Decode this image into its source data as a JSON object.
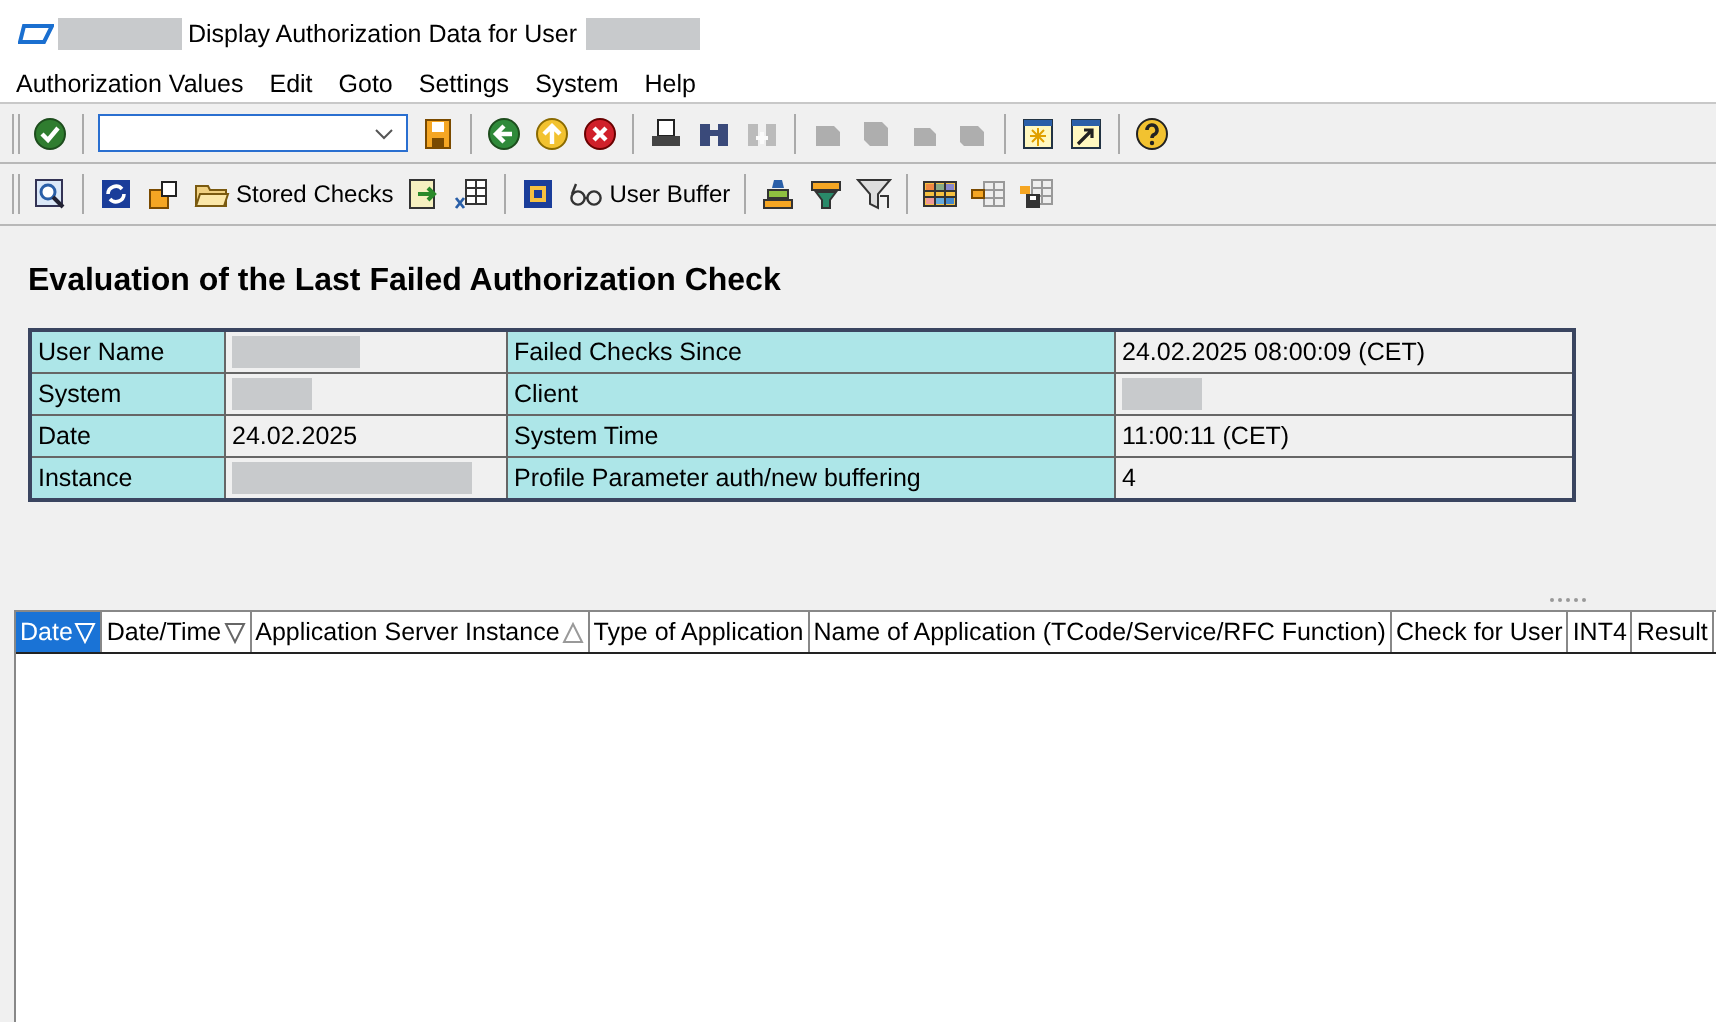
{
  "window": {
    "title": "Display Authorization Data for User",
    "title_redacted": true,
    "user_redacted": true
  },
  "menu": [
    "Authorization Values",
    "Edit",
    "Goto",
    "Settings",
    "System",
    "Help"
  ],
  "toolbar": [
    {
      "kind": "button",
      "disabled": false
    },
    {
      "kind": "separator"
    },
    {
      "kind": "field"
    },
    {
      "kind": "button",
      "disabled": false
    },
    {
      "kind": "separator"
    },
    {
      "kind": "button",
      "disabled": false
    },
    {
      "kind": "button",
      "disabled": false
    },
    {
      "kind": "button",
      "disabled": false
    },
    {
      "kind": "separator"
    },
    {
      "kind": "button",
      "disabled": false
    },
    {
      "kind": "button",
      "disabled": false
    },
    {
      "kind": "button",
      "disabled": true
    },
    {
      "kind": "separator"
    },
    {
      "kind": "button",
      "disabled": true
    },
    {
      "kind": "button",
      "disabled": true
    },
    {
      "kind": "button",
      "disabled": true
    },
    {
      "kind": "button",
      "disabled": true
    },
    {
      "kind": "separator"
    },
    {
      "kind": "button",
      "disabled": false
    },
    {
      "kind": "button",
      "disabled": false
    },
    {
      "kind": "separator"
    },
    {
      "kind": "button",
      "disabled": false
    }
  ],
  "app_toolbar": [
    {
      "kind": "button"
    },
    {
      "kind": "separator"
    },
    {
      "kind": "button"
    },
    {
      "kind": "button"
    },
    {
      "kind": "button",
      "label": "Stored Checks"
    },
    {
      "kind": "button"
    },
    {
      "kind": "button"
    },
    {
      "kind": "separator"
    },
    {
      "kind": "button"
    },
    {
      "kind": "button",
      "label": "User Buffer"
    },
    {
      "kind": "separator"
    },
    {
      "kind": "button"
    },
    {
      "kind": "button"
    },
    {
      "kind": "button"
    },
    {
      "kind": "separator"
    },
    {
      "kind": "button"
    },
    {
      "kind": "button"
    },
    {
      "kind": "button"
    }
  ],
  "heading": "Evaluation of the Last Failed Authorization Check",
  "info_rows": [
    [
      {
        "label": "User Name",
        "redacted": true
      },
      {
        "label": "Failed Checks Since",
        "value": "24.02.2025 08:00:09 (CET)"
      }
    ],
    [
      {
        "label": "System",
        "redacted": true
      },
      {
        "label": "Client",
        "redacted": true
      }
    ],
    [
      {
        "label": "Date",
        "value": "24.02.2025"
      },
      {
        "label": "System Time",
        "value": "11:00:11 (CET)"
      }
    ],
    [
      {
        "label": "Instance",
        "redacted": true
      },
      {
        "label": "Profile Parameter auth/new buffering",
        "value": "4"
      }
    ]
  ],
  "grid": {
    "columns": [
      {
        "label": "Date",
        "selected": true,
        "sorted": true,
        "descending": true
      },
      {
        "label": "Date/Time",
        "selected": false,
        "sorted": true,
        "descending": true
      },
      {
        "label": "Application Server Instance",
        "selected": false,
        "sorted": true,
        "descending": false
      },
      {
        "label": "Type of Application",
        "selected": false,
        "sorted": false
      },
      {
        "label": "Name of Application (TCode/Service/RFC Function)",
        "selected": false,
        "sorted": false
      },
      {
        "label": "Check for User",
        "selected": false,
        "sorted": false
      },
      {
        "label": "INT4",
        "selected": false,
        "sorted": false
      },
      {
        "label": "Result",
        "selected": false,
        "sorted": false
      }
    ]
  }
}
